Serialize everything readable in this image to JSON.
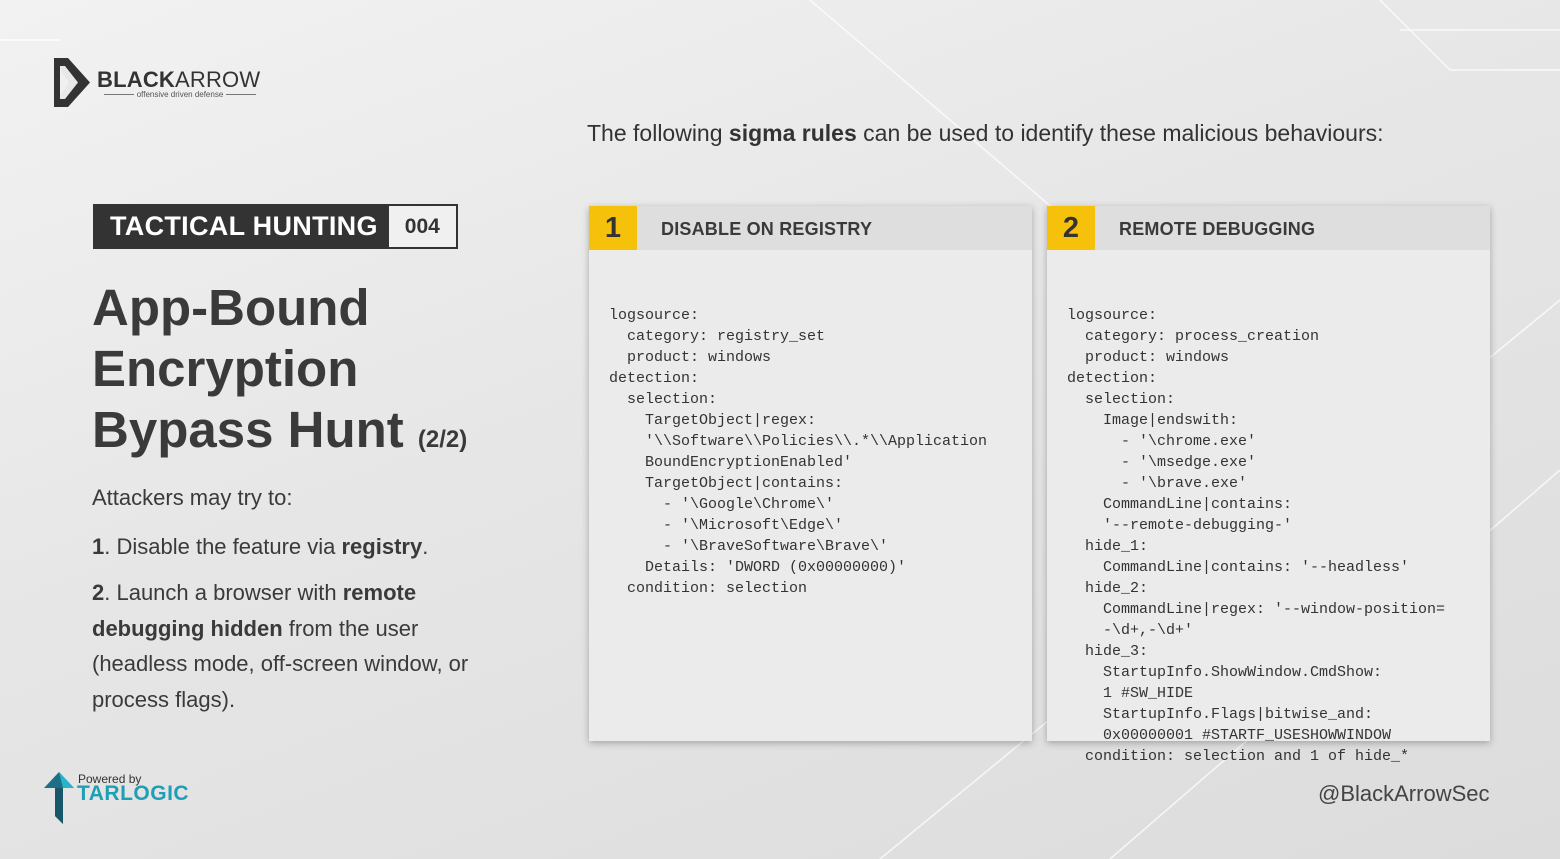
{
  "brand": {
    "name_bold": "BLACK",
    "name_light": "ARROW",
    "tagline": "offensive driven defense"
  },
  "badge": {
    "label": "TACTICAL HUNTING",
    "number": "004"
  },
  "title": {
    "lines": [
      "App-Bound",
      "Encryption",
      "Bypass Hunt"
    ],
    "part": "(2/2)"
  },
  "intro": "Attackers may try to:",
  "steps": [
    {
      "num": "1",
      "pre": ". Disable the feature via ",
      "bold": "registry",
      "post": "."
    },
    {
      "num": "2",
      "pre": ". Launch a browser with ",
      "bold": "remote debugging hidden",
      "post": " from the user (headless mode, off-screen window, or process flags)."
    }
  ],
  "lead": {
    "pre": "The following ",
    "bold": "sigma rules",
    "post": " can be used to identify these malicious behaviours:"
  },
  "rules": [
    {
      "num": "1",
      "title": "DISABLE ON REGISTRY",
      "code": [
        "logsource:",
        "  category: registry_set",
        "  product: windows",
        "detection:",
        "  selection:",
        "    TargetObject|regex:",
        "    '\\\\Software\\\\Policies\\\\.*\\\\Application",
        "    BoundEncryptionEnabled'",
        "    TargetObject|contains:",
        "      - '\\Google\\Chrome\\'",
        "      - '\\Microsoft\\Edge\\'",
        "      - '\\BraveSoftware\\Brave\\'",
        "    Details: 'DWORD (0x00000000)'",
        "  condition: selection"
      ]
    },
    {
      "num": "2",
      "title": "REMOTE DEBUGGING",
      "code": [
        "logsource:",
        "  category: process_creation",
        "  product: windows",
        "detection:",
        "  selection:",
        "    Image|endswith:",
        "      - '\\chrome.exe'",
        "      - '\\msedge.exe'",
        "      - '\\brave.exe'",
        "    CommandLine|contains:",
        "    '--remote-debugging-'",
        "  hide_1:",
        "    CommandLine|contains: '--headless'",
        "  hide_2:",
        "    CommandLine|regex: '--window-position=",
        "    -\\d+,-\\d+'",
        "  hide_3:",
        "    StartupInfo.ShowWindow.CmdShow:",
        "    1 #SW_HIDE",
        "    StartupInfo.Flags|bitwise_and:",
        "    0x00000001 #STARTF_USESHOWWINDOW",
        "  condition: selection and 1 of hide_*"
      ]
    }
  ],
  "powered": {
    "small": "Powered by",
    "big": "TARLOGIC"
  },
  "handle": "@BlackArrowSec",
  "colors": {
    "accent": "#f6c10a",
    "dark": "#333333",
    "tarlogic": "#1e9fb6"
  }
}
